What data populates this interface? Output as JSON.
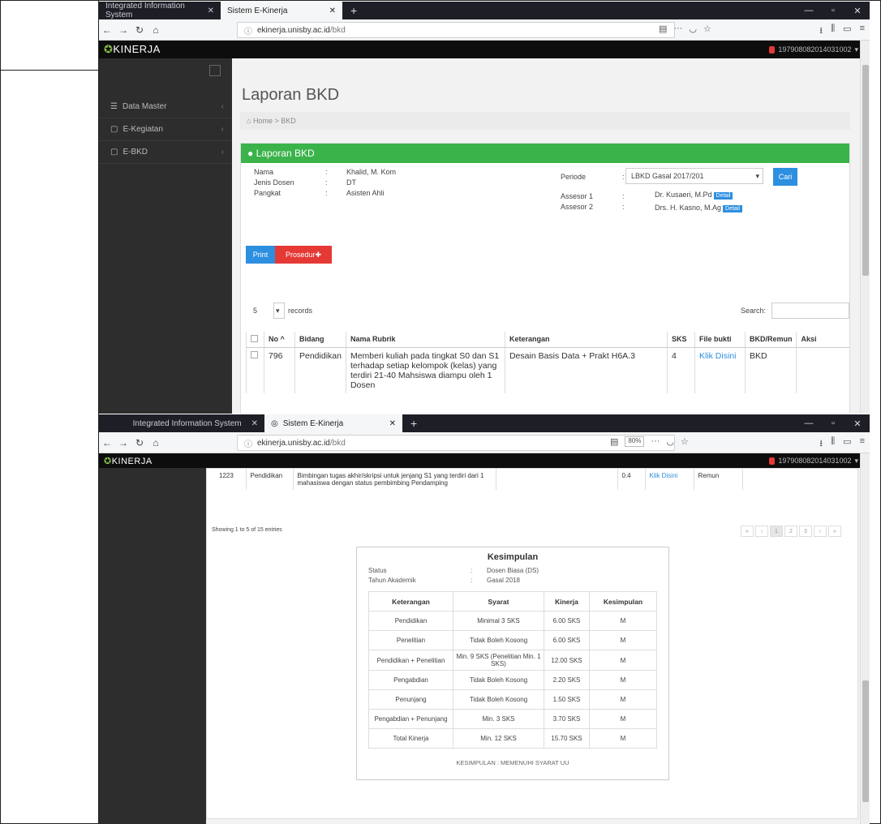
{
  "s1": {
    "tabs": [
      "Integrated Information System",
      "Sistem E-Kinerja"
    ],
    "url": {
      "prefix": "ⓘ",
      "host": "ekinerja.unisby.ac.id",
      "path": "/bkd"
    },
    "zoom": "",
    "logo": "KINERJA",
    "user": "197908082014031002",
    "sidebar": [
      "Data Master",
      "E-Kegiatan",
      "E-BKD"
    ],
    "page_title": "Laporan BKD",
    "breadcrumb": "Home > BKD",
    "panel_title": "Laporan BKD",
    "profile": {
      "labels": [
        "Nama",
        "Jenis Dosen",
        "Pangkat"
      ],
      "values": [
        "Khalid, M. Kom",
        "DT",
        "Asisten Ahli"
      ]
    },
    "periode": {
      "label": "Periode",
      "value": "LBKD Gasal 2017/201"
    },
    "assessors": {
      "labels": [
        "Assesor 1",
        "Assesor 2"
      ],
      "values": [
        "Dr. Kusaeri, M.Pd",
        "Drs. H. Kasno, M.Ag"
      ]
    },
    "detail": "Detail",
    "cari": "Cari",
    "print": "Print",
    "prosedur": "Prosedur",
    "records_value": "5",
    "records_label": "records",
    "search_label": "Search:",
    "columns": [
      "",
      "No",
      "Bidang",
      "Nama Rubrik",
      "Keterangan",
      "SKS",
      "File bukti",
      "BKD/Remun",
      "Aksi"
    ],
    "row": {
      "no": "796",
      "bidang": "Pendidikan",
      "rubrik": "Memberi kuliah pada tingkat S0 dan S1 terhadap setiap kelompok (kelas) yang terdiri 21-40 Mahsiswa diampu oleh 1 Dosen",
      "ket": "Desain Basis Data + Prakt H6A.3",
      "sks": "4",
      "file": "Klik Disini",
      "bkd": "BKD"
    }
  },
  "s2": {
    "tabs": [
      "Integrated Information System",
      "Sistem E-Kinerja"
    ],
    "url": {
      "prefix": "ⓘ",
      "host": "ekinerja.unisby.ac.id",
      "path": "/bkd"
    },
    "zoom": "80%",
    "logo": "KINERJA",
    "user": "197908082014031002",
    "row": {
      "no": "1223",
      "bidang": "Pendidikan",
      "rubrik": "Bimbingan tugas akhir/skripsi untuk jenjang S1 yang terdiri dari 1 mahasiswa dengan status pembimbing Pendamping",
      "sks": "0.4",
      "file": "Klik Disini",
      "bkd": "Remun"
    },
    "showing": "Showing 1 to 5 of 15 entries",
    "pager": [
      "«",
      "‹",
      "1",
      "2",
      "3",
      "›",
      "»"
    ],
    "kesimpulan": {
      "title": "Kesimpulan",
      "info_labels": [
        "Status",
        "Tahun Akademik"
      ],
      "info_values": [
        "Dosen Biasa (DS)",
        "Gasal 2018"
      ],
      "headers": [
        "Keterangan",
        "Syarat",
        "Kinerja",
        "Kesimpulan"
      ],
      "rows": [
        [
          "Pendidikan",
          "Minimal 3 SKS",
          "6.00 SKS",
          "M"
        ],
        [
          "Penelitian",
          "Tidak Boleh Kosong",
          "6.00 SKS",
          "M"
        ],
        [
          "Pendidikan + Penelitian",
          "Min. 9 SKS (Penelitian Min. 1 SKS)",
          "12.00 SKS",
          "M"
        ],
        [
          "Pengabdian",
          "Tidak Boleh Kosong",
          "2.20 SKS",
          "M"
        ],
        [
          "Penunjang",
          "Tidak Boleh Kosong",
          "1.50 SKS",
          "M"
        ],
        [
          "Pengabdian + Penunjang",
          "Min. 3 SKS",
          "3.70 SKS",
          "M"
        ],
        [
          "Total Kinerja",
          "Min. 12 SKS",
          "15.70 SKS",
          "M"
        ]
      ],
      "footer": "KESIMPULAN : MEMENUHI SYARAT UU"
    }
  }
}
